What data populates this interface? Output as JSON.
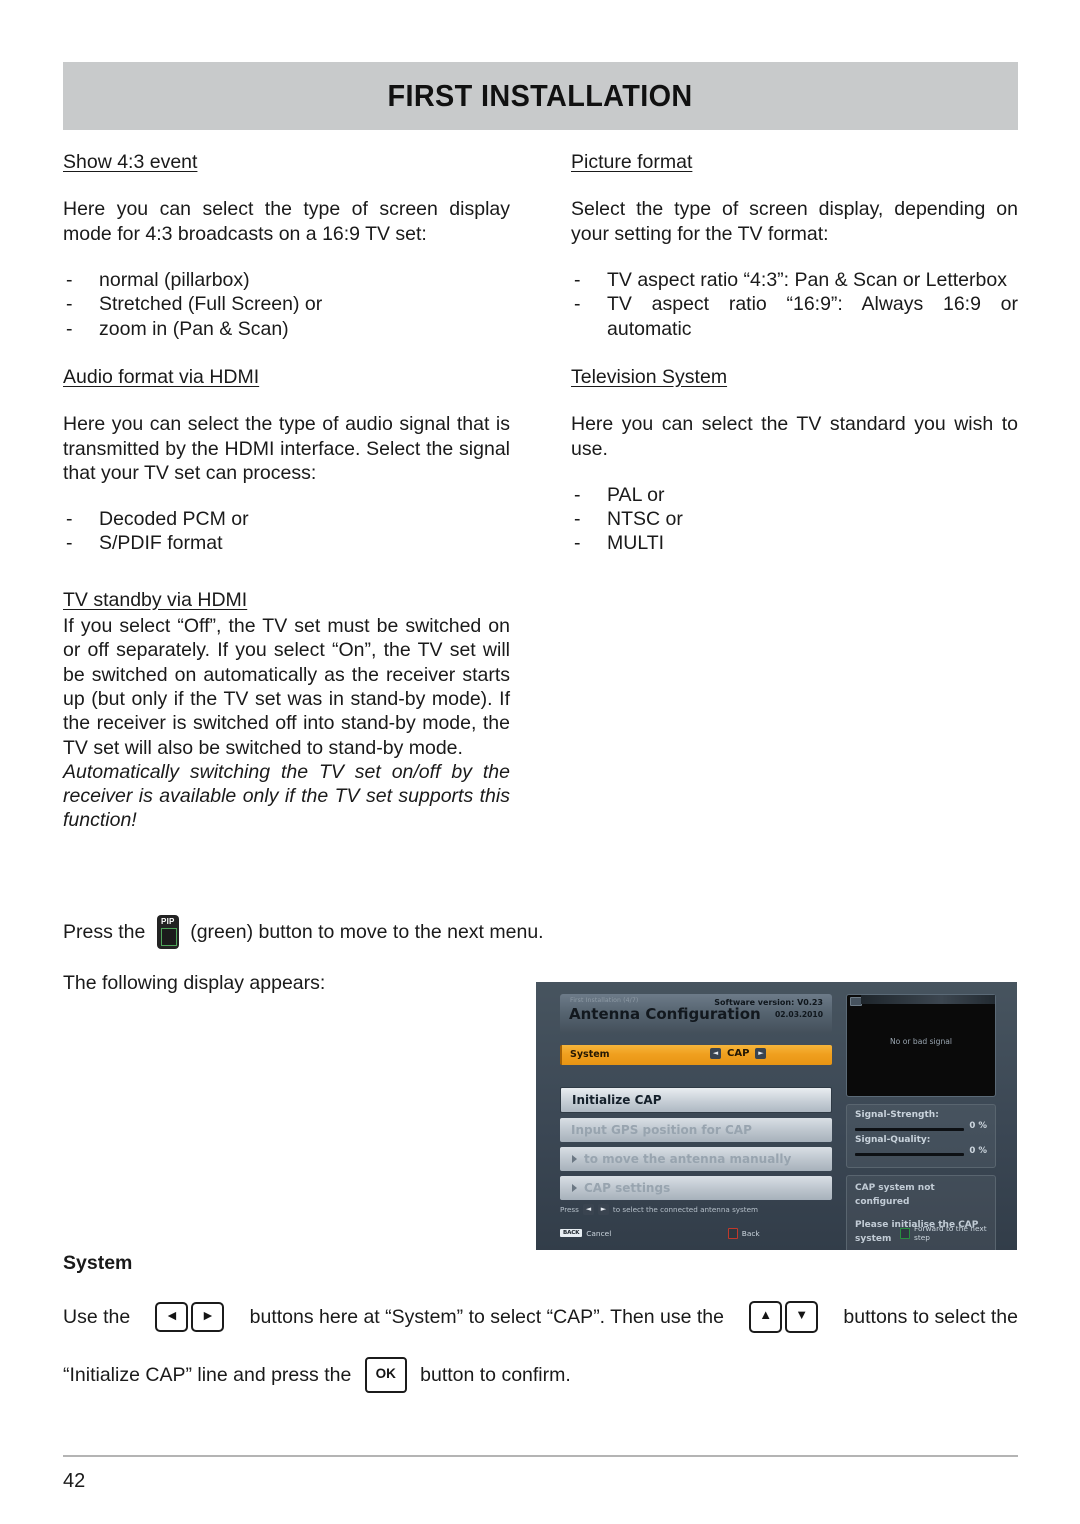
{
  "header": {
    "title": "FIRST INSTALLATION"
  },
  "left_column": {
    "section1": {
      "heading": "Show 4:3 event",
      "paragraph": "Here you can select the type of screen display mode for 4:3 broadcasts on a 16:9 TV set:",
      "items": [
        "normal (pillarbox)",
        "Stretched (Full Screen) or",
        "zoom in (Pan & Scan)"
      ]
    },
    "section2": {
      "heading": "Audio format via HDMI",
      "paragraph": "Here you can select the type of audio signal that is transmitted by the HDMI interface. Select the signal that your TV set can process:",
      "items": [
        "Decoded PCM or",
        "S/PDIF format"
      ]
    },
    "section3": {
      "heading": "TV standby via HDMI",
      "paragraph": "If you select “Off”, the TV set must be switched on or off separately. If you select “On”, the TV set will be switched on automatically as the receiver starts up (but only if the TV set was in stand-by mode). If the receiver is switched off into stand-by mode, the TV set will also be switched to stand-by mode.",
      "note": "Automatically switching the TV set on/off by the receiver is available only if the TV set supports this function!"
    }
  },
  "right_column": {
    "section1": {
      "heading": "Picture format",
      "paragraph": "Select the type of screen display, depending on your setting for the TV format:",
      "items": [
        "TV aspect ratio “4:3”: Pan & Scan or Letterbox",
        "TV aspect ratio “16:9”: Always 16:9 or automatic"
      ]
    },
    "section2": {
      "heading": "Television System",
      "paragraph": "Here you can select the TV standard you wish to use.",
      "items": [
        "PAL or",
        "NTSC or",
        "MULTI"
      ]
    }
  },
  "press_block": {
    "prefix": "Press the ",
    "key_label": "PIP",
    "suffix": " (green) button to move to the next menu.",
    "following": "The following display appears:"
  },
  "osd": {
    "step": "First Installation (4/7)",
    "title": "Antenna Configuration",
    "software_version": "Software version: V0.23",
    "date": "02.03.2010",
    "system_row": {
      "label": "System",
      "left_arrow": "◄",
      "value": "CAP",
      "right_arrow": "►"
    },
    "menu_items": [
      {
        "label": "Initialize CAP",
        "state": "selected",
        "arrow": false
      },
      {
        "label": "Input GPS position for CAP",
        "state": "dim",
        "arrow": false
      },
      {
        "label": "to move the antenna manually",
        "state": "dim",
        "arrow": true
      },
      {
        "label": "CAP settings",
        "state": "dim",
        "arrow": true
      }
    ],
    "preview_message": "No or bad signal",
    "signal": {
      "strength_label": "Signal-Strength:",
      "strength_value": "0 %",
      "quality_label": "Signal-Quality:",
      "quality_value": "0 %"
    },
    "notes": [
      "CAP system not configured",
      "Please initialise the CAP system"
    ],
    "footer": {
      "hint_prefix": "Press",
      "hint_left": "◄",
      "hint_right": "►",
      "hint_suffix": "to select the connected antenna system",
      "cancel_key": "BACK",
      "cancel_label": "Cancel",
      "back_label": "Back",
      "forward_label": "Forward to the next step"
    },
    "colors": {
      "highlight": "#f0a01f",
      "panel_bg": "#3b4754",
      "red_key": "#c0392b",
      "green_key": "#27903f"
    }
  },
  "system_section": {
    "title": "System",
    "line1_part1": "Use the ",
    "key_left": "◄",
    "key_right": "►",
    "line1_part2": " buttons here at “System” to select “CAP”. Then use the ",
    "key_up": "▲",
    "key_down": "▼",
    "line1_part3": " buttons to select the",
    "line2_part1": "“Initialize CAP” line and press the ",
    "key_ok": "OK",
    "line2_part2": " button to confirm."
  },
  "footer": {
    "page_number": "42"
  }
}
